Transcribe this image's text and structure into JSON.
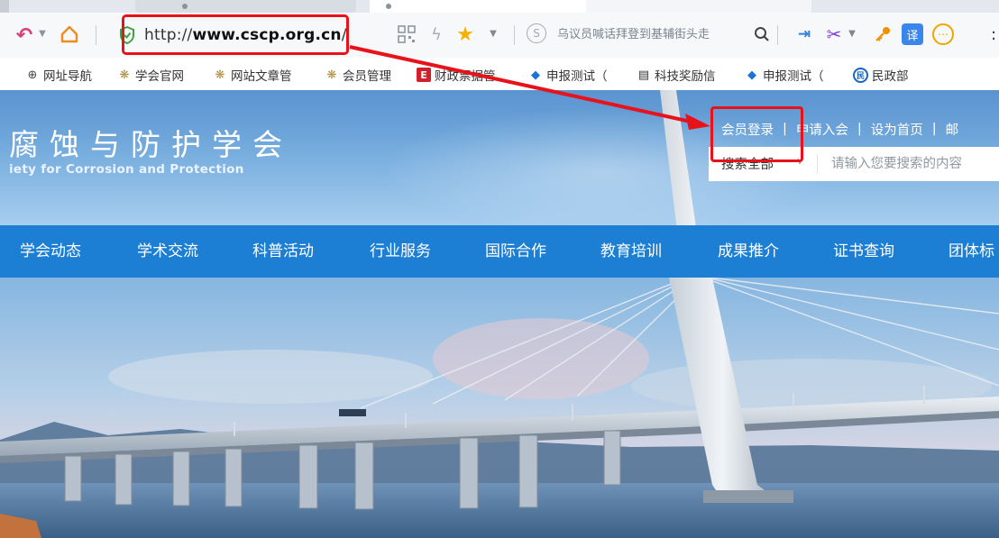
{
  "browser": {
    "address_bar": {
      "url_prefix": "http://",
      "url_host": "www.cscp.org.cn",
      "url_suffix": "/"
    },
    "search_suggestion": "乌议员喊话拜登到基辅街头走"
  },
  "bookmarks": [
    {
      "label": "网址导航",
      "icon": "globe-icon"
    },
    {
      "label": "学会官网",
      "icon": "flower-icon"
    },
    {
      "label": "网站文章管",
      "icon": "flower-icon"
    },
    {
      "label": "会员管理",
      "icon": "flower-icon"
    },
    {
      "label": "财政票据管",
      "icon": "e-badge-icon"
    },
    {
      "label": "申报测试（",
      "icon": "diamond-icon"
    },
    {
      "label": "科技奖励信",
      "icon": "document-icon"
    },
    {
      "label": "申报测试（",
      "icon": "diamond-icon"
    },
    {
      "label": "民政部",
      "icon": "mz-badge-icon"
    }
  ],
  "site": {
    "title": "腐蚀与防护学会",
    "subtitle": "iety for Corrosion and Protection",
    "toplinks": {
      "login": "会员登录",
      "join": "申请入会",
      "homepage": "设为首页",
      "more": "邮"
    },
    "search": {
      "scope": "搜索全部",
      "placeholder": "请输入您要搜索的内容"
    },
    "nav": [
      "学会动态",
      "学术交流",
      "科普活动",
      "行业服务",
      "国际合作",
      "教育培训",
      "成果推介",
      "证书查询",
      "团体标"
    ]
  },
  "annotations": {
    "highlight_color": "#e8121a"
  },
  "colors": {
    "nav_bg": "#1c7fd3",
    "header_sky": "#6ea6da"
  }
}
